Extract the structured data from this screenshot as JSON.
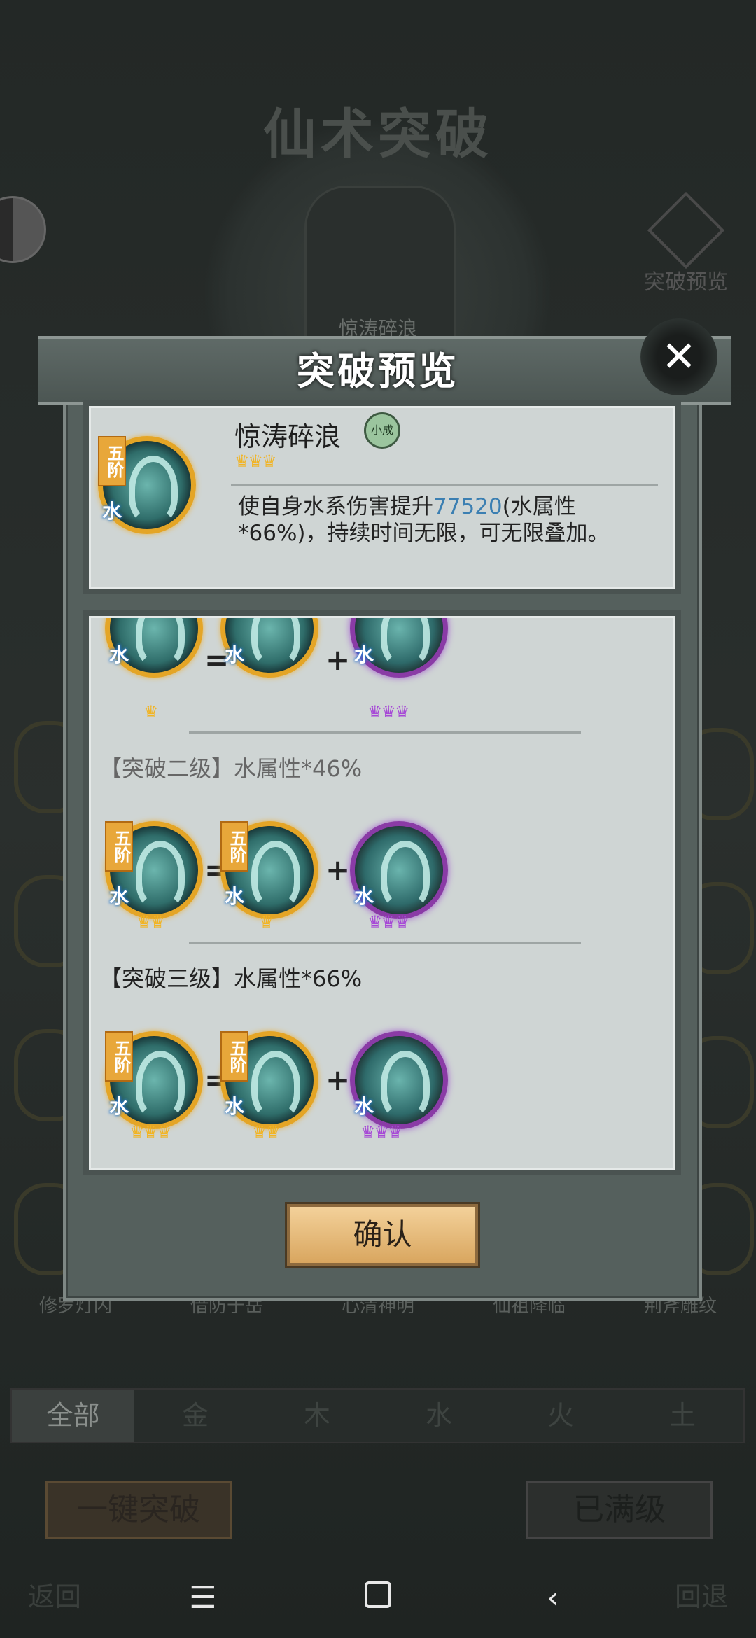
{
  "background": {
    "title": "仙术突破",
    "card_tier": "五阶",
    "card_name": "惊涛碎浪",
    "preview_button": "突破预览",
    "skill_names": [
      "修罗灯闪",
      "借防于岳",
      "心清神明",
      "仙祖降临",
      "荆斧雕纹"
    ],
    "tabs": [
      "全部",
      "金",
      "木",
      "水",
      "火",
      "土"
    ],
    "one_click_button": "一键突破",
    "maxed_button": "已满级",
    "return_label": "返回",
    "undo_label": "回退"
  },
  "modal": {
    "title": "突破预览",
    "close_glyph": "✕",
    "skill": {
      "tier": "五阶",
      "element": "水",
      "name": "惊涛碎浪",
      "rank_badge": "小成",
      "stars": "♛♛♛",
      "desc_prefix": "使自身水系伤害提升",
      "desc_number": "77520",
      "desc_suffix": "(水属性*66%)，持续时间无限，可无限叠加。"
    },
    "levels": [
      {
        "label": "",
        "equals": "=",
        "plus": "+",
        "result_stars": "♛",
        "base_stars": "",
        "material_stars": "♛♛♛"
      },
      {
        "label": "【突破二级】水属性*46%",
        "equals": "=",
        "plus": "+",
        "result_stars": "♛♛",
        "base_stars": "♛",
        "material_stars": "♛♛♛"
      },
      {
        "label": "【突破三级】水属性*66%",
        "equals": "=",
        "plus": "+",
        "result_stars": "♛♛♛",
        "base_stars": "♛♛",
        "material_stars": "♛♛♛"
      }
    ],
    "confirm_button": "确认"
  },
  "system_nav": {
    "menu_glyph": "☰",
    "back_glyph": "‹"
  }
}
